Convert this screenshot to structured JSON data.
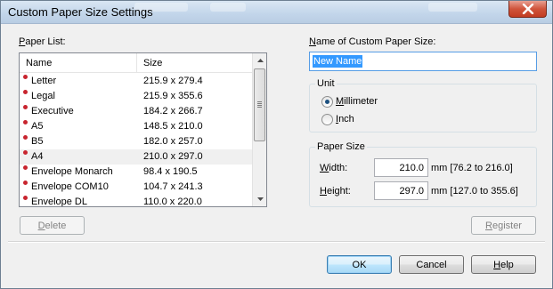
{
  "window": {
    "title": "Custom Paper Size Settings",
    "close_icon": "close-icon"
  },
  "paper_list": {
    "label_prefix": "",
    "label_accel": "P",
    "label_rest": "aper List:",
    "columns": [
      "Name",
      "Size"
    ],
    "rows": [
      {
        "name": "Letter",
        "size": "215.9 x 279.4"
      },
      {
        "name": "Legal",
        "size": "215.9 x 355.6"
      },
      {
        "name": "Executive",
        "size": "184.2 x 266.7"
      },
      {
        "name": "A5",
        "size": "148.5 x 210.0"
      },
      {
        "name": "B5",
        "size": "182.0 x 257.0"
      },
      {
        "name": "A4",
        "size": "210.0 x 297.0"
      },
      {
        "name": "Envelope Monarch",
        "size": "98.4 x 190.5"
      },
      {
        "name": "Envelope COM10",
        "size": "104.7 x 241.3"
      },
      {
        "name": "Envelope DL",
        "size": "110.0 x 220.0"
      }
    ],
    "selected_index": 5,
    "row_marker_color": "#c8242e"
  },
  "delete_button": {
    "accel": "D",
    "rest": "elete"
  },
  "custom_name": {
    "label_accel": "N",
    "label_rest": "ame of Custom Paper Size:",
    "value": "New Name"
  },
  "unit": {
    "title": "Unit",
    "options": [
      {
        "accel": "M",
        "rest": "illimeter",
        "checked": true
      },
      {
        "accel": "I",
        "rest": "nch",
        "checked": false
      }
    ]
  },
  "paper_size": {
    "title": "Paper Size",
    "width": {
      "accel": "W",
      "rest": "idth:",
      "value": "210.0",
      "range": "mm [76.2 to 216.0]"
    },
    "height": {
      "accel": "H",
      "rest": "eight:",
      "value": "297.0",
      "range": "mm [127.0 to 355.6]"
    }
  },
  "register_button": {
    "accel": "R",
    "rest": "egister"
  },
  "footer": {
    "ok": "OK",
    "cancel": "Cancel",
    "help_accel": "H",
    "help_rest": "elp"
  },
  "colors": {
    "accent": "#3399ff",
    "close_button": "#c23b22"
  }
}
